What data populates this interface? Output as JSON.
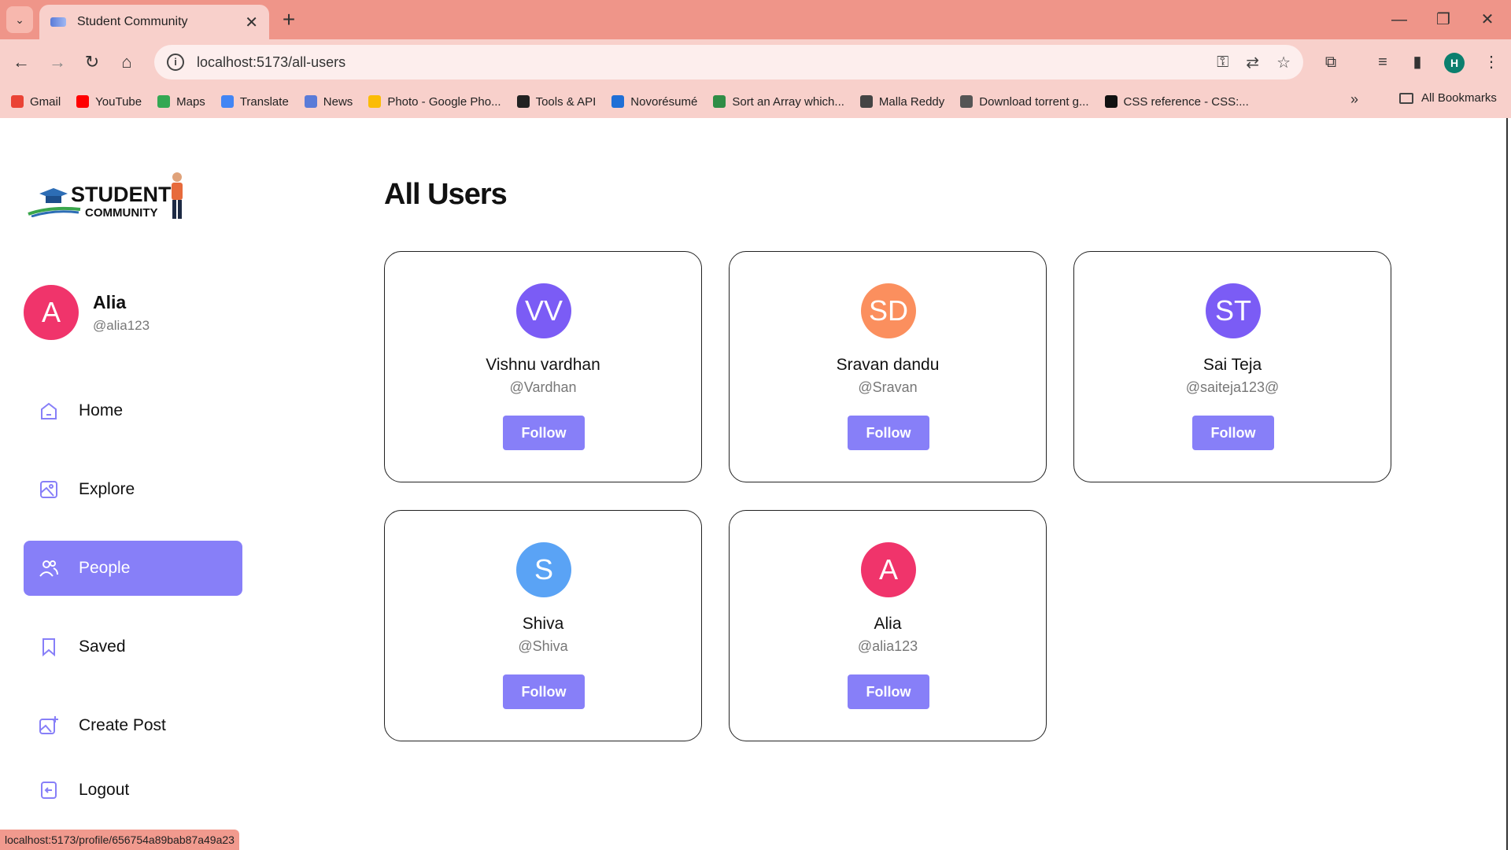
{
  "browser": {
    "tab_title": "Student Community",
    "url": "localhost:5173/all-users",
    "profile_initial": "H",
    "bookmarks": [
      {
        "label": "Gmail",
        "color": "#ea4335"
      },
      {
        "label": "YouTube",
        "color": "#ff0000"
      },
      {
        "label": "Maps",
        "color": "#34a853"
      },
      {
        "label": "Translate",
        "color": "#4285f4"
      },
      {
        "label": "News",
        "color": "#5a7bd8"
      },
      {
        "label": "Photo - Google Pho...",
        "color": "#fbbc05"
      },
      {
        "label": "Tools & API",
        "color": "#222222"
      },
      {
        "label": "Novorésumé",
        "color": "#1f6fd6"
      },
      {
        "label": "Sort an Array which...",
        "color": "#2f8d46"
      },
      {
        "label": "Malla Reddy",
        "color": "#444444"
      },
      {
        "label": "Download torrent g...",
        "color": "#555555"
      },
      {
        "label": "CSS reference - CSS:...",
        "color": "#111111"
      }
    ],
    "all_bookmarks": "All Bookmarks",
    "status_url": "localhost:5173/profile/656754a89bab87a49a23"
  },
  "sidebar": {
    "logo_line1": "STUDENT",
    "logo_line2": "COMMUNITY",
    "user": {
      "initial": "A",
      "name": "Alia",
      "handle": "@alia123"
    },
    "nav": [
      {
        "label": "Home",
        "icon": "home-icon"
      },
      {
        "label": "Explore",
        "icon": "explore-icon"
      },
      {
        "label": "People",
        "icon": "people-icon",
        "active": true
      },
      {
        "label": "Saved",
        "icon": "bookmark-icon"
      },
      {
        "label": "Create Post",
        "icon": "create-post-icon"
      },
      {
        "label": "Logout",
        "icon": "logout-icon"
      }
    ]
  },
  "main": {
    "title": "All Users",
    "users": [
      {
        "initials": "VV",
        "name": "Vishnu vardhan",
        "handle": "@Vardhan",
        "color": "#7b5cf5",
        "button": "Follow"
      },
      {
        "initials": "SD",
        "name": "Sravan dandu",
        "handle": "@Sravan",
        "color": "#fb8f5e",
        "button": "Follow"
      },
      {
        "initials": "ST",
        "name": "Sai Teja",
        "handle": "@saiteja123@",
        "color": "#7b5cf5",
        "button": "Follow"
      },
      {
        "initials": "S",
        "name": "Shiva",
        "handle": "@Shiva",
        "color": "#5aa3f5",
        "button": "Follow"
      },
      {
        "initials": "A",
        "name": "Alia",
        "handle": "@alia123",
        "color": "#f0346b",
        "button": "Follow"
      }
    ]
  },
  "colors": {
    "accent": "#877ff8",
    "chrome": "#ef9589",
    "chrome_light": "#f8d0cb"
  }
}
